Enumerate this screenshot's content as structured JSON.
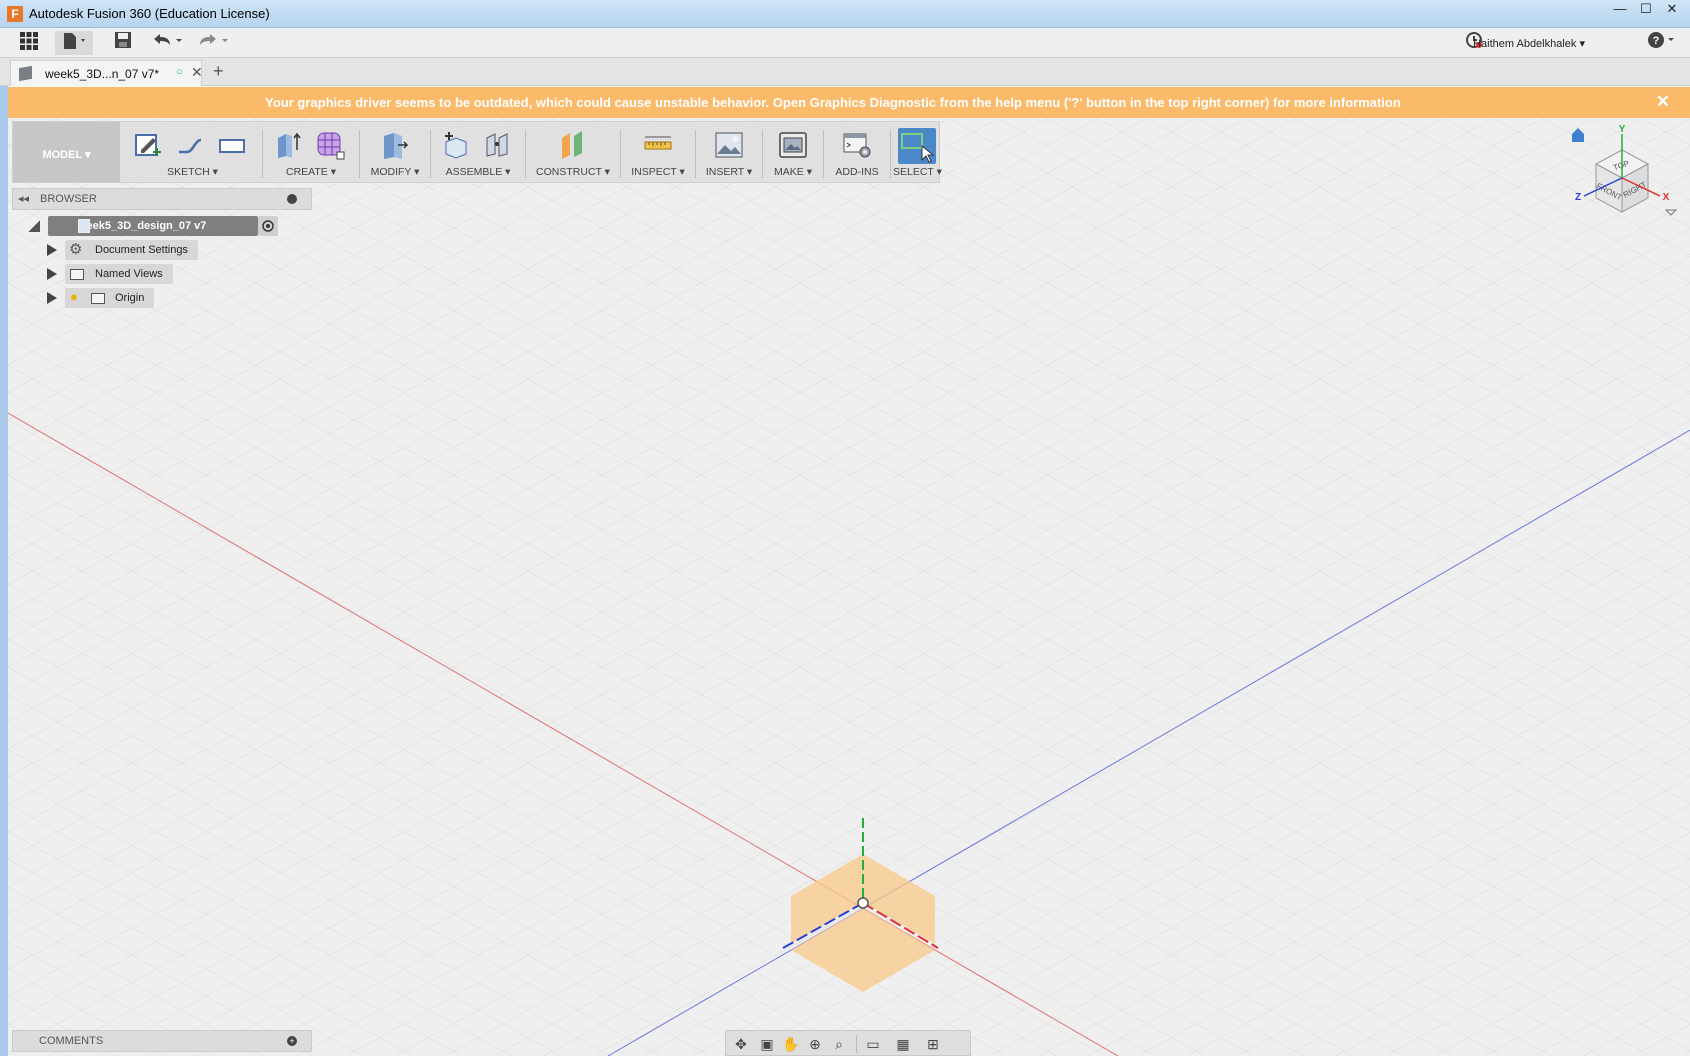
{
  "window": {
    "title": "Autodesk Fusion 360 (Education License)",
    "app_icon": "F",
    "minimize": "—",
    "maximize": "☐",
    "close": "✕"
  },
  "quickaccess": {
    "user": "Haithem Abdelkhalek ▾",
    "help": "?"
  },
  "tab": {
    "label": "week5_3D...n_07 v7*",
    "add": "+"
  },
  "banner": {
    "message": "Your graphics driver seems to be outdated, which could cause unstable behavior. Open Graphics Diagnostic from the help menu ('?' button in the top right corner) for more information",
    "close": "✕"
  },
  "toolbar": {
    "mode": "MODEL ▾",
    "groups": {
      "sketch": "SKETCH ▾",
      "create": "CREATE ▾",
      "modify": "MODIFY ▾",
      "assemble": "ASSEMBLE ▾",
      "construct": "CONSTRUCT ▾",
      "inspect": "INSPECT ▾",
      "insert": "INSERT ▾",
      "make": "MAKE ▾",
      "addins": "ADD-INS",
      "select": "SELECT ▾"
    }
  },
  "browser": {
    "title": "BROWSER",
    "root": "week5_3D_design_07 v7",
    "items": [
      "Document Settings",
      "Named Views",
      "Origin"
    ]
  },
  "comments": {
    "title": "COMMENTS"
  },
  "viewcube": {
    "top": "TOP",
    "front": "FRONT",
    "right": "RIGHT",
    "x": "X",
    "y": "Y",
    "z": "Z"
  },
  "colors": {
    "banner": "#fbb96a",
    "x_axis": "#e03030",
    "y_axis": "#20b040",
    "z_axis": "#2a3fd8",
    "plane": "#f9c98a"
  }
}
